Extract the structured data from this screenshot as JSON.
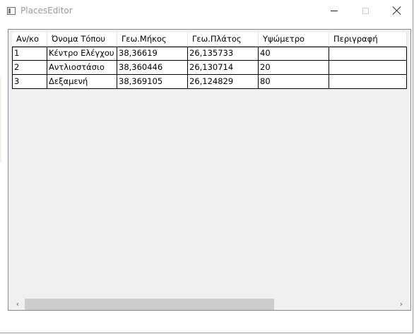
{
  "window": {
    "title": "PlacesEditor"
  },
  "title_buttons": {
    "minimize": "minimize-icon",
    "maximize": "maximize-icon",
    "close": "close-icon"
  },
  "grid": {
    "columns": [
      "Αν/κο",
      "Όνομα Τόπου",
      "Γεω.Μήκος",
      "Γεω.Πλάτος",
      "Υψώμετρο",
      "Περιγραφή"
    ],
    "rows": [
      [
        "1",
        "Κέντρο Ελέγχου",
        "38,36619",
        "26,135733",
        "40",
        ""
      ],
      [
        "2",
        "Αντλιοστάσιο",
        "38,360446",
        "26,130714",
        "20",
        ""
      ],
      [
        "3",
        "Δεξαμενή",
        "38,369105",
        "26,124829",
        "80",
        ""
      ]
    ]
  },
  "scrollbar": {
    "left_arrow": "‹",
    "right_arrow": "›"
  },
  "colors": {
    "grid_border": "#828790",
    "grid_bg": "#f0f0f0",
    "thumb": "#cdcdcd"
  }
}
